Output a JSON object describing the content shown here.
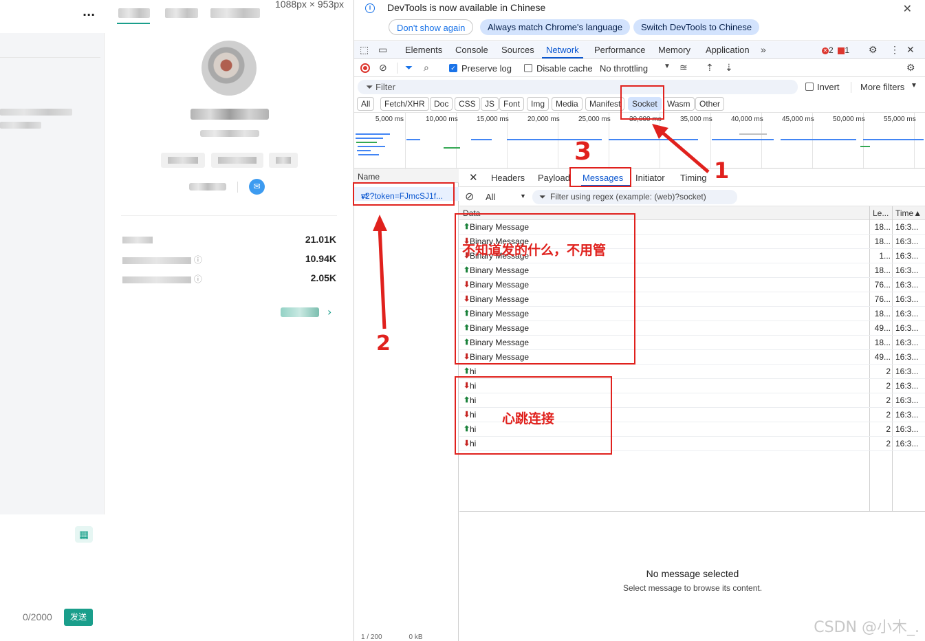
{
  "page": {
    "dimension_readout": "1088px × 953px",
    "char_counter": "0/2000",
    "send_label": "发送",
    "stats": [
      {
        "value": "21.01K"
      },
      {
        "value": "10.94K"
      },
      {
        "value": "2.05K"
      }
    ]
  },
  "devtools": {
    "infobar": {
      "text": "DevTools is now available in Chinese",
      "btn_dont_show": "Don't show again",
      "btn_match": "Always match Chrome's language",
      "btn_switch": "Switch DevTools to Chinese"
    },
    "tabs": [
      "Elements",
      "Console",
      "Sources",
      "Network",
      "Performance",
      "Memory",
      "Application"
    ],
    "errors": "2",
    "warnings": "1",
    "toolbar": {
      "preserve_log": "Preserve log",
      "disable_cache": "Disable cache",
      "throttling": "No throttling"
    },
    "filter": {
      "placeholder": "Filter",
      "invert": "Invert",
      "more_filters": "More filters"
    },
    "types": [
      "All",
      "Fetch/XHR",
      "Doc",
      "CSS",
      "JS",
      "Font",
      "Img",
      "Media",
      "Manifest",
      "Socket",
      "Wasm",
      "Other"
    ],
    "overview_ticks": [
      "5,000 ms",
      "10,000 ms",
      "15,000 ms",
      "20,000 ms",
      "25,000 ms",
      "30,000 ms",
      "35,000 ms",
      "40,000 ms",
      "45,000 ms",
      "50,000 ms",
      "55,000 ms"
    ],
    "requests": {
      "name_header": "Name",
      "item": "v2?token=FJmcSJ1f..."
    },
    "detail_tabs": [
      "Headers",
      "Payload",
      "Messages",
      "Initiator",
      "Timing"
    ],
    "msg_filter": {
      "type": "All",
      "regex_placeholder": "Filter using regex (example: (web)?socket)"
    },
    "columns": {
      "data": "Data",
      "length": "Le...",
      "time": "Time▲"
    },
    "messages": [
      {
        "dir": "up",
        "data": "Binary Message",
        "length": "18...",
        "time": "16:3..."
      },
      {
        "dir": "down",
        "data": "Binary Message",
        "length": "18...",
        "time": "16:3..."
      },
      {
        "dir": "down",
        "data": "Binary Message",
        "length": "1...",
        "time": "16:3..."
      },
      {
        "dir": "up",
        "data": "Binary Message",
        "length": "18...",
        "time": "16:3..."
      },
      {
        "dir": "down",
        "data": "Binary Message",
        "length": "76...",
        "time": "16:3..."
      },
      {
        "dir": "down",
        "data": "Binary Message",
        "length": "76...",
        "time": "16:3..."
      },
      {
        "dir": "up",
        "data": "Binary Message",
        "length": "18...",
        "time": "16:3..."
      },
      {
        "dir": "up",
        "data": "Binary Message",
        "length": "49...",
        "time": "16:3..."
      },
      {
        "dir": "up",
        "data": "Binary Message",
        "length": "18...",
        "time": "16:3..."
      },
      {
        "dir": "down",
        "data": "Binary Message",
        "length": "49...",
        "time": "16:3..."
      },
      {
        "dir": "up",
        "data": "hi",
        "length": "2",
        "time": "16:3..."
      },
      {
        "dir": "down",
        "data": "hi",
        "length": "2",
        "time": "16:3..."
      },
      {
        "dir": "up",
        "data": "hi",
        "length": "2",
        "time": "16:3..."
      },
      {
        "dir": "down",
        "data": "hi",
        "length": "2",
        "time": "16:3..."
      },
      {
        "dir": "up",
        "data": "hi",
        "length": "2",
        "time": "16:3..."
      },
      {
        "dir": "down",
        "data": "hi",
        "length": "2",
        "time": "16:3..."
      }
    ],
    "empty_title": "No message selected",
    "empty_sub": "Select message to browse its content."
  },
  "annotations": {
    "num1": "1",
    "num2": "2",
    "num3": "3",
    "note_binary": "不知道发的什么，不用管",
    "note_heartbeat": "心跳连接"
  },
  "watermark": "CSDN @小木_."
}
